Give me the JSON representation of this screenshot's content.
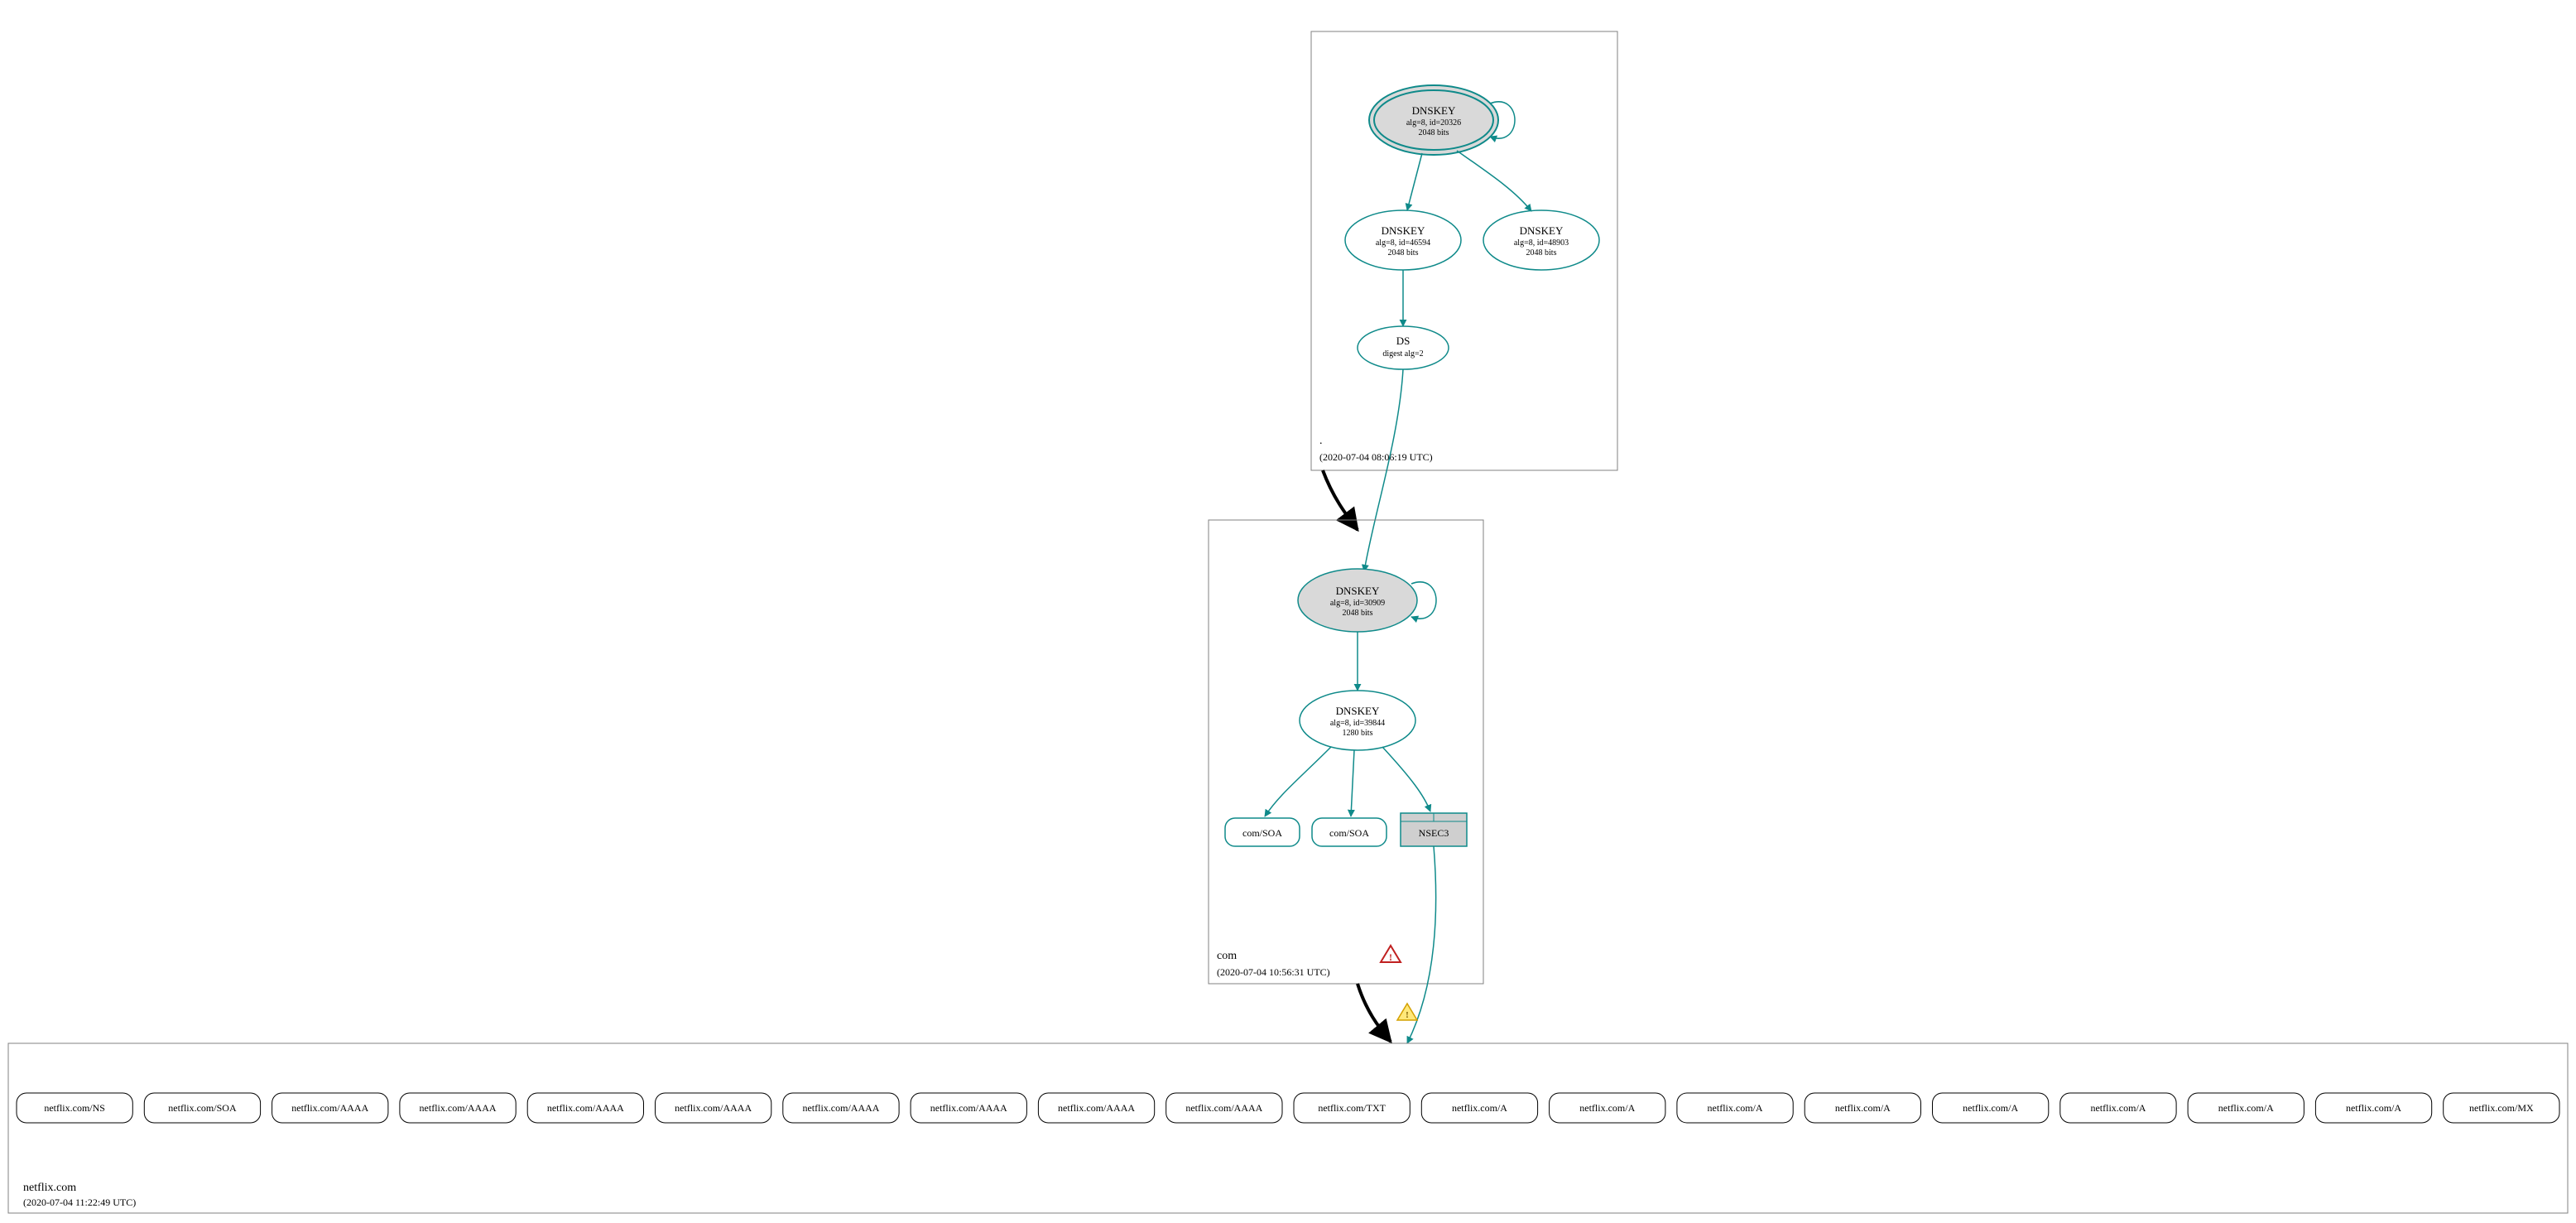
{
  "colors": {
    "teal": "#0f8a8a",
    "gray_fill": "#d9d9d9",
    "box_stroke": "#808080",
    "warn_yellow_fill": "#ffe87a",
    "warn_yellow_stroke": "#d4a000",
    "warn_red_stroke": "#c02020"
  },
  "zones": {
    "root": {
      "name": ".",
      "timestamp": "(2020-07-04 08:06:19 UTC)"
    },
    "com": {
      "name": "com",
      "timestamp": "(2020-07-04 10:56:31 UTC)"
    },
    "netflix": {
      "name": "netflix.com",
      "timestamp": "(2020-07-04 11:22:49 UTC)"
    }
  },
  "nodes": {
    "root_ksk": {
      "title": "DNSKEY",
      "line2": "alg=8, id=20326",
      "line3": "2048 bits"
    },
    "root_zsk1": {
      "title": "DNSKEY",
      "line2": "alg=8, id=46594",
      "line3": "2048 bits"
    },
    "root_zsk2": {
      "title": "DNSKEY",
      "line2": "alg=8, id=48903",
      "line3": "2048 bits"
    },
    "root_ds": {
      "title": "DS",
      "line2": "digest alg=2"
    },
    "com_ksk": {
      "title": "DNSKEY",
      "line2": "alg=8, id=30909",
      "line3": "2048 bits"
    },
    "com_zsk": {
      "title": "DNSKEY",
      "line2": "alg=8, id=39844",
      "line3": "1280 bits"
    },
    "com_soa1": {
      "title": "com/SOA"
    },
    "com_soa2": {
      "title": "com/SOA"
    },
    "nsec3": {
      "title": "NSEC3"
    }
  },
  "records": [
    "netflix.com/NS",
    "netflix.com/SOA",
    "netflix.com/AAAA",
    "netflix.com/AAAA",
    "netflix.com/AAAA",
    "netflix.com/AAAA",
    "netflix.com/AAAA",
    "netflix.com/AAAA",
    "netflix.com/AAAA",
    "netflix.com/AAAA",
    "netflix.com/TXT",
    "netflix.com/A",
    "netflix.com/A",
    "netflix.com/A",
    "netflix.com/A",
    "netflix.com/A",
    "netflix.com/A",
    "netflix.com/A",
    "netflix.com/A",
    "netflix.com/MX"
  ]
}
